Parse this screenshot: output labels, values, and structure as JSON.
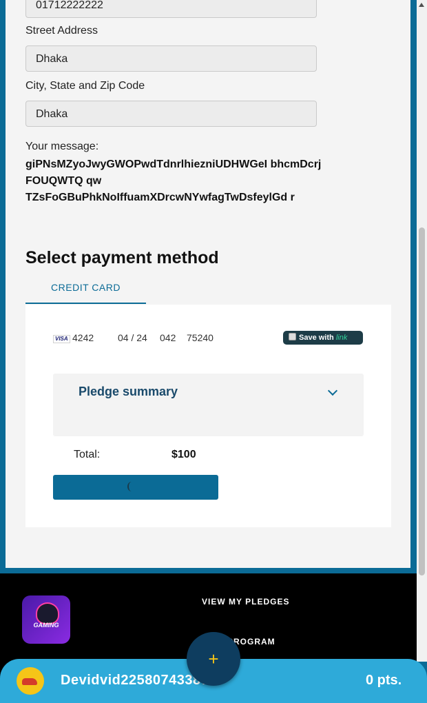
{
  "form": {
    "phone_value": "01712222222",
    "street_label": "Street Address",
    "street_value": "Dhaka",
    "city_label": "City, State and Zip Code",
    "city_value": "Dhaka",
    "message_label": "Your message:",
    "message_text": "giPNsMZyoJwyGWOPwdTdnrlhiezniUDHWGeI bhcmDcrj FOUQWTQ qw TZsFoGBuPhkNoIffuamXDrcwNYwfagTwDsfeylGd r"
  },
  "payment": {
    "title": "Select payment method",
    "tab_label": "CREDIT CARD",
    "card_brand": "VISA",
    "card_number": "4242",
    "card_expiry": "04 / 24",
    "card_cvc": "042",
    "card_zip": "75240",
    "save_with_label": "Save with",
    "link_label": "link",
    "pledge_summary_label": "Pledge summary",
    "total_label": "Total:",
    "total_value": "$100"
  },
  "footer": {
    "logo_text": "GAMING",
    "nav_view_pledges": "VIEW MY PLEDGES",
    "nav_program": "PROGRAM"
  },
  "bottom_bar": {
    "username": "Devidvid22580743387",
    "points": "0 pts."
  },
  "fab": {
    "icon": "plus-icon",
    "symbol": "+"
  },
  "colors": {
    "primary": "#0b6b96",
    "bar": "#2eaad9",
    "fab": "#0e3d5f",
    "accent": "#f5c518"
  }
}
